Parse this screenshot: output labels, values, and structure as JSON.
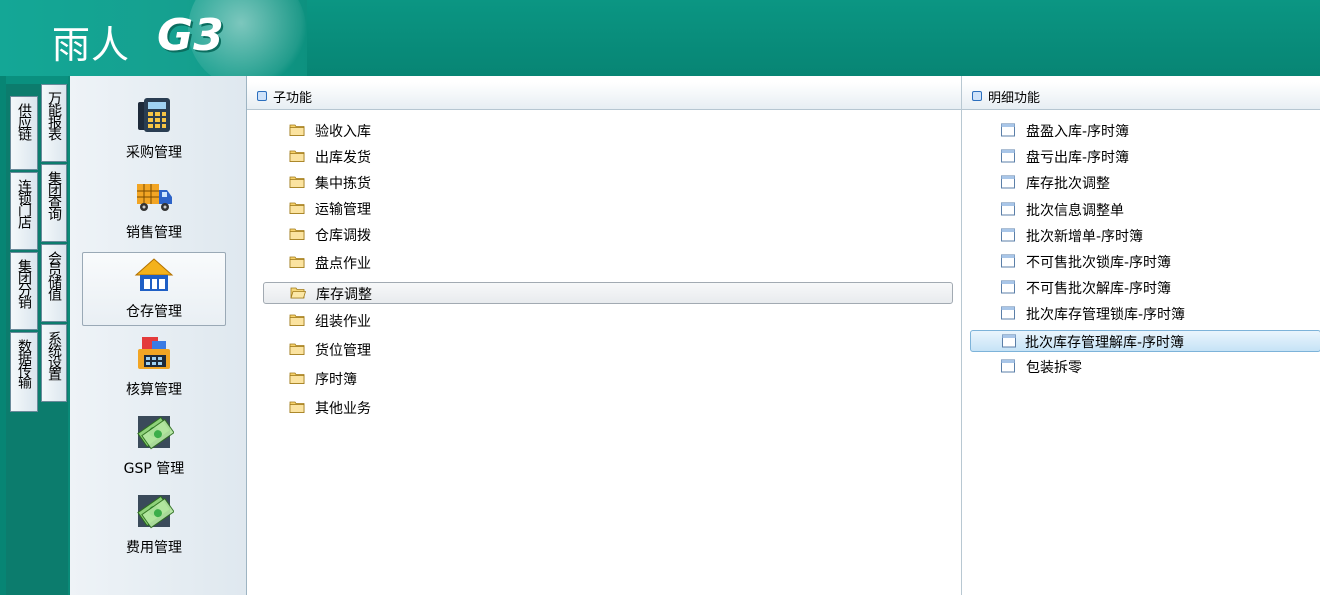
{
  "app": {
    "logo_text": "雨人",
    "logo_version": "G3"
  },
  "vtabs_outer": [
    "供应链",
    "连锁门店",
    "集团分销",
    "数据传输"
  ],
  "vtabs_inner": [
    "万能报表",
    "集团查询",
    "会员储值",
    "系统设置"
  ],
  "nav_items": [
    {
      "label": "采购管理",
      "icon": "cash-register-icon"
    },
    {
      "label": "销售管理",
      "icon": "delivery-truck-icon"
    },
    {
      "label": "仓存管理",
      "icon": "warehouse-icon",
      "selected": true
    },
    {
      "label": "核算管理",
      "icon": "accounting-icon"
    },
    {
      "label": "GSP 管理",
      "icon": "gsp-money-icon"
    },
    {
      "label": "费用管理",
      "icon": "expense-money-icon"
    }
  ],
  "sub_panel": {
    "title": "子功能",
    "items": [
      {
        "label": "验收入库"
      },
      {
        "label": "出库发货"
      },
      {
        "label": "集中拣货"
      },
      {
        "label": "运输管理"
      },
      {
        "label": "仓库调拨"
      },
      {
        "label": "盘点作业"
      },
      {
        "label": "库存调整",
        "selected": true
      },
      {
        "label": "组装作业"
      },
      {
        "label": "货位管理"
      },
      {
        "label": "序时簿"
      },
      {
        "label": "其他业务"
      }
    ]
  },
  "detail_panel": {
    "title": "明细功能",
    "items": [
      {
        "label": "盘盈入库-序时簿"
      },
      {
        "label": "盘亏出库-序时簿"
      },
      {
        "label": "库存批次调整"
      },
      {
        "label": "批次信息调整单"
      },
      {
        "label": "批次新增单-序时簿"
      },
      {
        "label": "不可售批次锁库-序时簿"
      },
      {
        "label": "不可售批次解库-序时簿"
      },
      {
        "label": "批次库存管理锁库-序时簿"
      },
      {
        "label": "批次库存管理解库-序时簿",
        "selected": true
      },
      {
        "label": "包装拆零"
      }
    ]
  }
}
